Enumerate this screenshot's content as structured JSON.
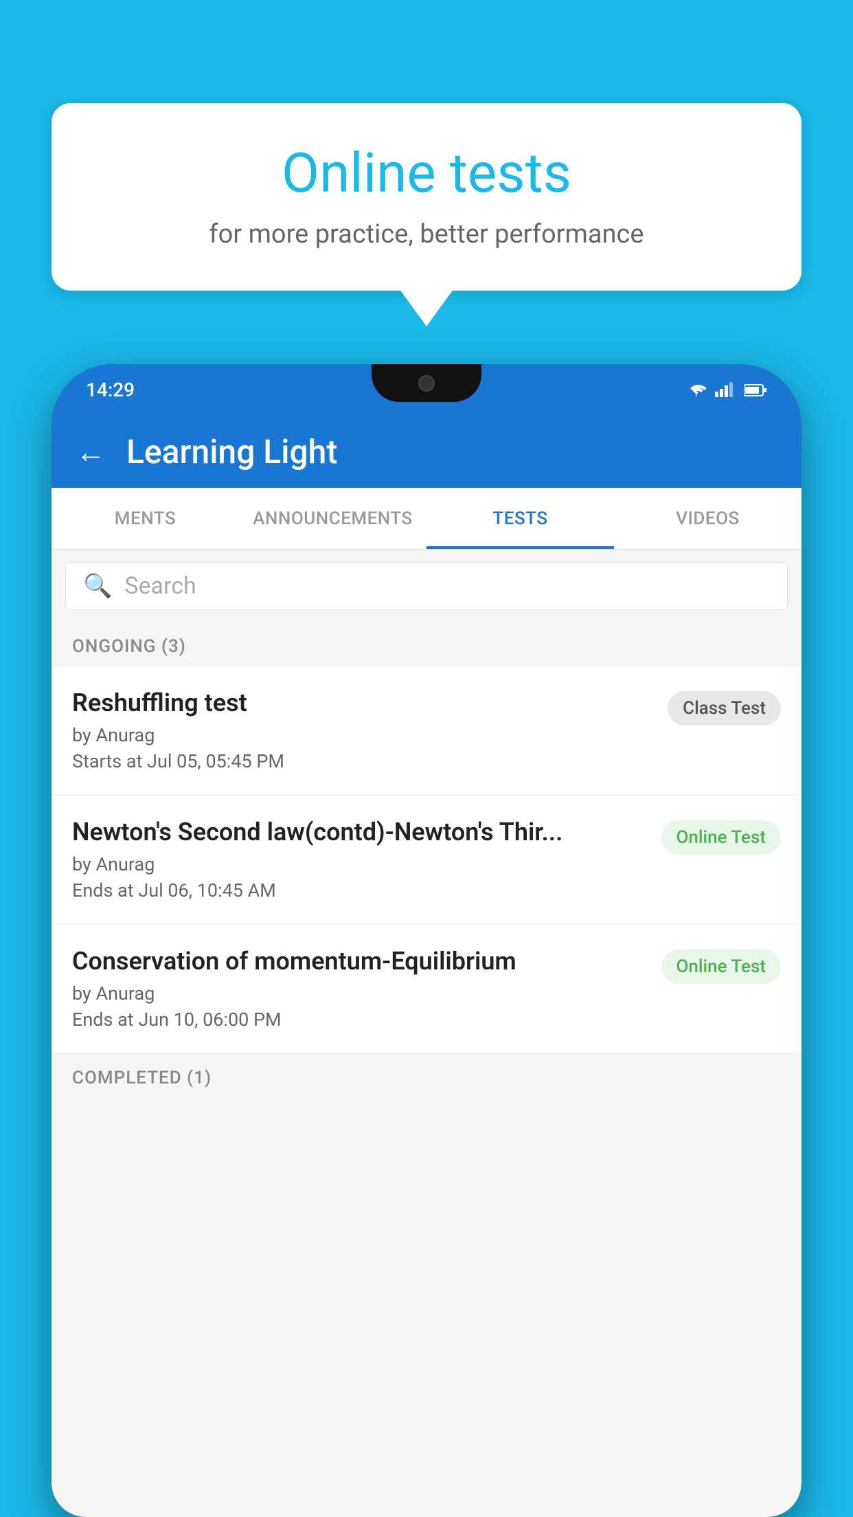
{
  "background_color": "#1BB8E8",
  "bubble": {
    "title": "Online tests",
    "subtitle": "for more practice, better performance"
  },
  "phone": {
    "status_bar": {
      "time": "14:29",
      "icons": [
        "wifi",
        "signal",
        "battery"
      ]
    },
    "app_bar": {
      "back_label": "←",
      "title": "Learning Light"
    },
    "tabs": [
      {
        "label": "MENTS",
        "active": false
      },
      {
        "label": "ANNOUNCEMENTS",
        "active": false
      },
      {
        "label": "TESTS",
        "active": true
      },
      {
        "label": "VIDEOS",
        "active": false
      }
    ],
    "search": {
      "placeholder": "Search"
    },
    "ongoing_section": {
      "title": "ONGOING (3)",
      "items": [
        {
          "title": "Reshuffling test",
          "author": "by Anurag",
          "date": "Starts at  Jul 05, 05:45 PM",
          "badge": "Class Test",
          "badge_type": "class"
        },
        {
          "title": "Newton's Second law(contd)-Newton's Thir...",
          "author": "by Anurag",
          "date": "Ends at  Jul 06, 10:45 AM",
          "badge": "Online Test",
          "badge_type": "online"
        },
        {
          "title": "Conservation of momentum-Equilibrium",
          "author": "by Anurag",
          "date": "Ends at  Jun 10, 06:00 PM",
          "badge": "Online Test",
          "badge_type": "online"
        }
      ]
    },
    "completed_section": {
      "title": "COMPLETED (1)"
    }
  }
}
